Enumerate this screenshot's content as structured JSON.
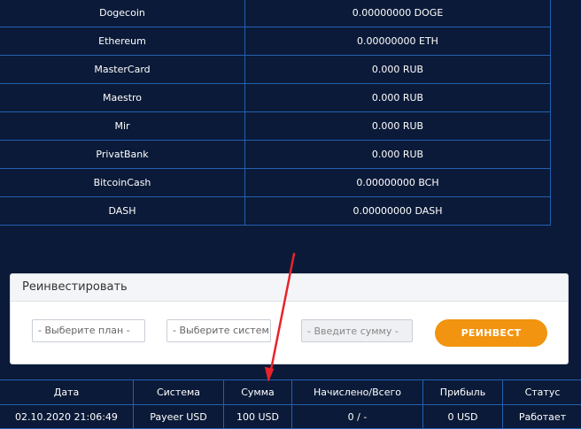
{
  "balances": [
    {
      "name": "Dogecoin",
      "amount": "0.00000000 DOGE"
    },
    {
      "name": "Ethereum",
      "amount": "0.00000000 ETH"
    },
    {
      "name": "MasterCard",
      "amount": "0.000 RUB"
    },
    {
      "name": "Maestro",
      "amount": "0.000 RUB"
    },
    {
      "name": "Mir",
      "amount": "0.000 RUB"
    },
    {
      "name": "PrivatBank",
      "amount": "0.000 RUB"
    },
    {
      "name": "BitcoinCash",
      "amount": "0.00000000 BCH"
    },
    {
      "name": "DASH",
      "amount": "0.00000000 DASH"
    }
  ],
  "reinvest": {
    "title": "Реинвестировать",
    "plan_select": "- Выберите план -",
    "system_select": "- Выберите систем",
    "amount_placeholder": "- Введите сумму -",
    "button_label": "РЕИНВЕСТ"
  },
  "deposits": {
    "headers": [
      "Дата",
      "Система",
      "Сумма",
      "Начислено/Всего",
      "Прибыль",
      "Статус"
    ],
    "rows": [
      [
        "02.10.2020 21:06:49",
        "Payeer USD",
        "100 USD",
        "0 / -",
        "0 USD",
        "Работает"
      ]
    ]
  },
  "colors": {
    "background": "#0b1a38",
    "table_border": "#2360b0",
    "button": "#f29410",
    "annotation_arrow": "#e8232a"
  }
}
